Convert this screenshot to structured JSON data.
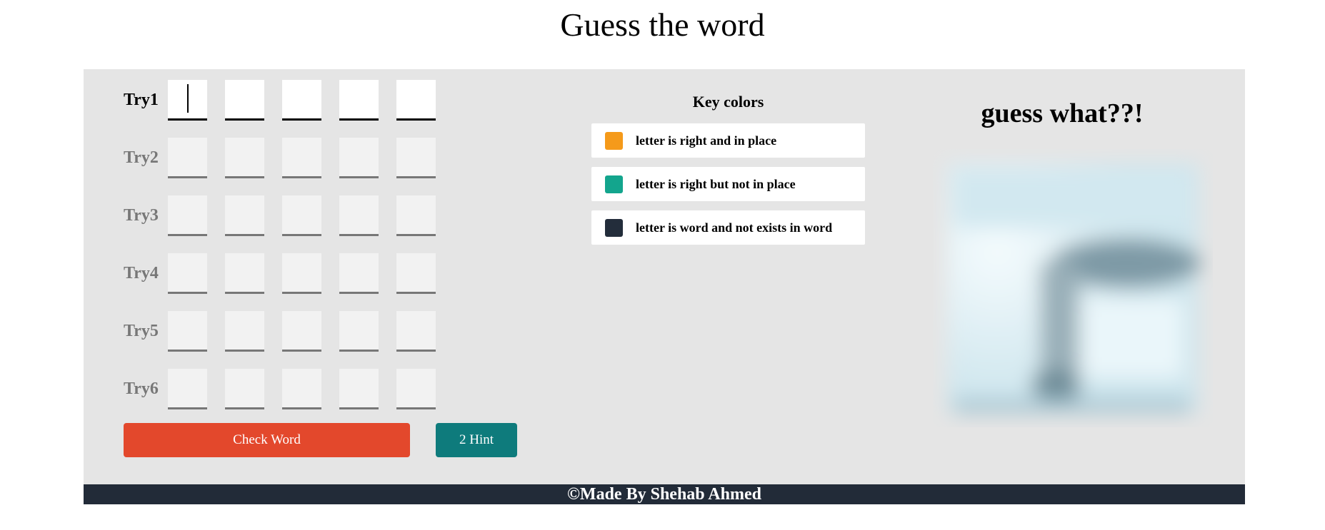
{
  "page": {
    "title": "Guess the word"
  },
  "tries": [
    {
      "label": "Try1",
      "active": true
    },
    {
      "label": "Try2",
      "active": false
    },
    {
      "label": "Try3",
      "active": false
    },
    {
      "label": "Try4",
      "active": false
    },
    {
      "label": "Try5",
      "active": false
    },
    {
      "label": "Try6",
      "active": false
    }
  ],
  "letters_per_try": 5,
  "buttons": {
    "check_label": "Check Word",
    "hint_label": "2 Hint"
  },
  "key_colors": {
    "title": "Key colors",
    "items": [
      {
        "text": "letter is right and in place",
        "color": "#f59a1a"
      },
      {
        "text": "letter is right but not in place",
        "color": "#13a58d"
      },
      {
        "text": "letter is word and not exists in word",
        "color": "#232d3b"
      }
    ]
  },
  "hint": {
    "heading": "guess what??!"
  },
  "footer": {
    "text": "©Made By Shehab Ahmed"
  },
  "colors": {
    "panel_bg": "#e5e5e5",
    "footer_bg": "#222b38",
    "check_button": "#e3482c",
    "hint_button": "#0e7b7c"
  }
}
